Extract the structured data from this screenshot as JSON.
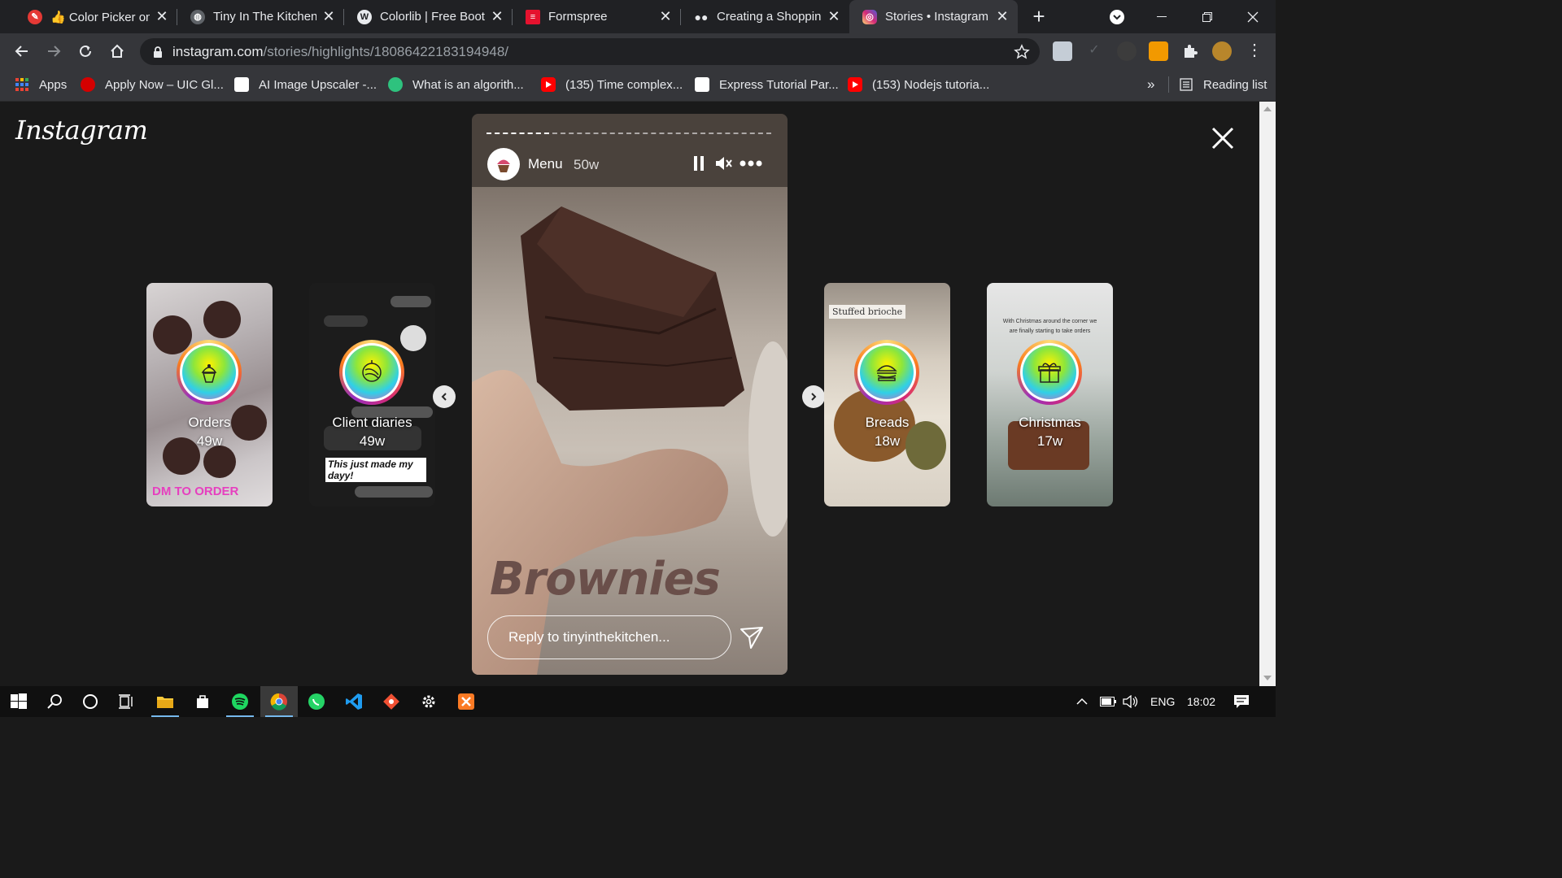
{
  "browser": {
    "tabs": [
      {
        "title": "👍 Color Picker onli",
        "favicon_color": "#e53935",
        "active": false
      },
      {
        "title": "Tiny In The Kitchen",
        "favicon_color": "#5f6368",
        "active": false
      },
      {
        "title": "Colorlib | Free Boots",
        "favicon_color": "#e8eaed",
        "active": false
      },
      {
        "title": "Formspree",
        "favicon_color": "#e5122e",
        "active": false
      },
      {
        "title": "Creating a Shopping",
        "favicon_color": "#e8eaed",
        "active": false
      },
      {
        "title": "Stories • Instagram",
        "favicon_color": "#d6249f",
        "active": true
      }
    ],
    "url_host": "instagram.com",
    "url_path": "/stories/highlights/18086422183194948/",
    "bookmarks": [
      {
        "label": "Apps",
        "color": "#4285f4"
      },
      {
        "label": "Apply Now – UIC Gl...",
        "color": "#d50000"
      },
      {
        "label": "AI Image Upscaler -...",
        "color": "#ffffff"
      },
      {
        "label": "What is an algorith...",
        "color": "#2ec27e"
      },
      {
        "label": "(135) Time complex...",
        "color": "#ff0000"
      },
      {
        "label": "Express Tutorial Par...",
        "color": "#ffffff"
      },
      {
        "label": "(153) Nodejs tutoria...",
        "color": "#ff0000"
      }
    ],
    "bookmarks_more": "»",
    "reading_list": "Reading list"
  },
  "instagram": {
    "logo": "Instagram",
    "highlights_left": [
      {
        "name": "Orders",
        "age": "49w",
        "overlay_text": "DM TO ORDER"
      },
      {
        "name": "Client diaries",
        "age": "49w",
        "overlay_text": "This just made my dayy!"
      }
    ],
    "highlights_right": [
      {
        "name": "Breads",
        "age": "18w",
        "overlay_text": "Stuffed brioche"
      },
      {
        "name": "Christmas",
        "age": "17w",
        "overlay_text": "With Christmas around the corner we are finally starting to take orders"
      }
    ],
    "story": {
      "username": "Menu",
      "age": "50w",
      "caption": "Brownies",
      "reply_placeholder": "Reply to tinyinthekitchen...",
      "progress": 0.22
    }
  },
  "taskbar": {
    "language": "ENG",
    "time": "18:02"
  }
}
